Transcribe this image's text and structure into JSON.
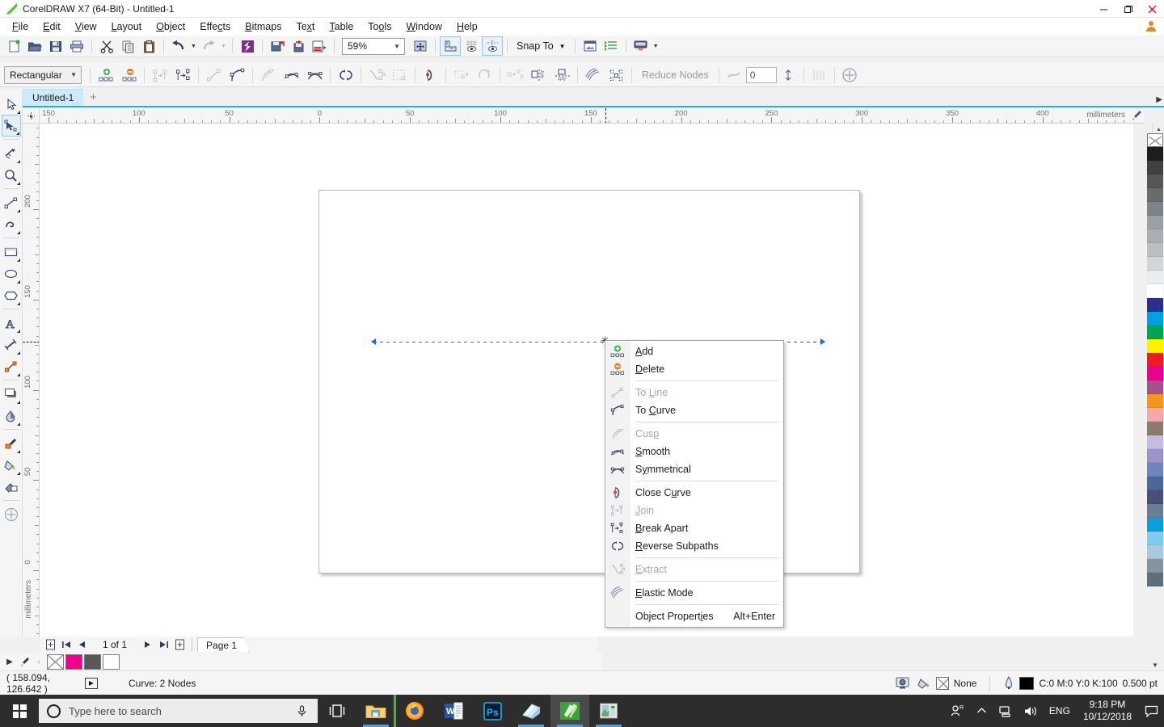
{
  "window": {
    "title": "CorelDRAW X7 (64-Bit) - Untitled-1",
    "app_icon": "coreldraw-icon",
    "minimize_label": "—",
    "maximize_label": "❐",
    "close_label": "✕"
  },
  "menubar": {
    "items": [
      {
        "label": "File",
        "accel": "F"
      },
      {
        "label": "Edit",
        "accel": "E"
      },
      {
        "label": "View",
        "accel": "V"
      },
      {
        "label": "Layout",
        "accel": "L"
      },
      {
        "label": "Object",
        "accel": "O"
      },
      {
        "label": "Effects",
        "accel": "c"
      },
      {
        "label": "Bitmaps",
        "accel": "B"
      },
      {
        "label": "Text",
        "accel": "x"
      },
      {
        "label": "Table",
        "accel": "T"
      },
      {
        "label": "Tools",
        "accel": "o"
      },
      {
        "label": "Window",
        "accel": "W"
      },
      {
        "label": "Help",
        "accel": "H"
      }
    ]
  },
  "standard_toolbar": {
    "buttons": [
      {
        "name": "new-document-icon",
        "title": "New"
      },
      {
        "name": "open-document-icon",
        "title": "Open"
      },
      {
        "name": "save-icon",
        "title": "Save"
      },
      {
        "name": "print-icon",
        "title": "Print"
      },
      {
        "name": "cut-icon",
        "title": "Cut"
      },
      {
        "name": "copy-icon",
        "title": "Copy"
      },
      {
        "name": "paste-icon",
        "title": "Paste"
      },
      {
        "name": "undo-icon",
        "title": "Undo"
      },
      {
        "name": "redo-icon",
        "title": "Redo"
      },
      {
        "name": "corel-connect-icon",
        "title": "Corel CONNECT"
      },
      {
        "name": "import-icon",
        "title": "Import"
      },
      {
        "name": "export-icon",
        "title": "Export"
      },
      {
        "name": "publish-pdf-icon",
        "title": "Publish to PDF"
      }
    ],
    "zoom_level": "59%",
    "zoom_dropdown_arrow": "⌄",
    "fullscreen_icon": "zoom-fit-icon",
    "rulers_icon": "show-rulers-icon",
    "grid_icon": "show-grid-icon",
    "guides_icon": "show-guides-icon",
    "snap_to_label": "Snap To",
    "snap_to_arrow": "▾",
    "options_icon": "options-icon",
    "object_manager_icon": "object-manager-icon",
    "application_launcher_icon": "application-launcher-icon",
    "launcher_arrow": "▾"
  },
  "property_bar": {
    "selection_mode": "Rectangular",
    "selection_mode_arrow": "⌄",
    "buttons": [
      {
        "name": "add-node-icon",
        "label": "Add Node(s)",
        "disabled": false
      },
      {
        "name": "delete-node-icon",
        "label": "Delete Node(s)",
        "disabled": false
      },
      {
        "name": "join-nodes-icon",
        "label": "Join Two Nodes",
        "disabled": true
      },
      {
        "name": "break-curve-icon",
        "label": "Break Curve",
        "disabled": false
      },
      {
        "name": "to-line-icon",
        "label": "Convert To Line",
        "disabled": true
      },
      {
        "name": "to-curve-icon",
        "label": "Convert To Curve",
        "disabled": false
      },
      {
        "name": "cusp-node-icon",
        "label": "Cusp Node",
        "disabled": true
      },
      {
        "name": "smooth-node-icon",
        "label": "Smooth Node",
        "disabled": false
      },
      {
        "name": "symmetrical-node-icon",
        "label": "Symmetrical Node",
        "disabled": false
      },
      {
        "name": "reverse-direction-icon",
        "label": "Reverse Direction",
        "disabled": false
      },
      {
        "name": "extend-curve-icon",
        "label": "Extend Curve To Close",
        "disabled": true
      },
      {
        "name": "extract-subpath-icon",
        "label": "Extract Subpath",
        "disabled": true
      },
      {
        "name": "close-curve-icon",
        "label": "Close Curve",
        "disabled": false
      },
      {
        "name": "stretch-nodes-icon",
        "label": "Stretch and Scale Nodes",
        "disabled": true
      },
      {
        "name": "rotate-nodes-icon",
        "label": "Rotate and Skew Nodes",
        "disabled": true
      },
      {
        "name": "align-nodes-icon",
        "label": "Align Nodes",
        "disabled": true
      },
      {
        "name": "reflect-horizontal-icon",
        "label": "Reflect Nodes Horizontally",
        "disabled": false
      },
      {
        "name": "reflect-vertical-icon",
        "label": "Reflect Nodes Vertically",
        "disabled": false
      },
      {
        "name": "elastic-mode-icon",
        "label": "Elastic Mode",
        "disabled": false
      },
      {
        "name": "select-all-nodes-icon",
        "label": "Select All Nodes",
        "disabled": false
      }
    ],
    "reduce_nodes_label": "Reduce Nodes",
    "curve_smoothness_value": "0",
    "curve_smoothness_icon": "curve-smoothness-icon",
    "spinner_icon": "spinner-icon",
    "zoom_nodes_icon": "zoom-nodes-icon",
    "add_node_plus_icon": "add-circle-icon"
  },
  "document_tabs": {
    "tabs": [
      {
        "label": "Untitled-1",
        "active": true
      }
    ],
    "new_tab_label": "+"
  },
  "toolbox": {
    "tools": [
      {
        "name": "pick-tool",
        "label": "Pick Tool",
        "selected": false,
        "flyout": true
      },
      {
        "name": "shape-tool",
        "label": "Shape Tool",
        "selected": true,
        "flyout": true
      },
      {
        "name": "crop-tool",
        "label": "Crop Tool",
        "selected": false,
        "flyout": true
      },
      {
        "name": "zoom-tool",
        "label": "Zoom Tool",
        "selected": false,
        "flyout": true
      },
      {
        "name": "freehand-tool",
        "label": "Freehand Tool",
        "selected": false,
        "flyout": true
      },
      {
        "name": "smart-fill-tool",
        "label": "Smart Fill Tool",
        "selected": false,
        "flyout": true
      },
      {
        "name": "rectangle-tool",
        "label": "Rectangle Tool",
        "selected": false,
        "flyout": true
      },
      {
        "name": "ellipse-tool",
        "label": "Ellipse Tool",
        "selected": false,
        "flyout": true
      },
      {
        "name": "polygon-tool",
        "label": "Polygon Tool",
        "selected": false,
        "flyout": true
      },
      {
        "name": "text-tool",
        "label": "Text Tool",
        "selected": false,
        "flyout": true
      },
      {
        "name": "parallel-dimension-tool",
        "label": "Parallel Dimension Tool",
        "selected": false,
        "flyout": true
      },
      {
        "name": "straight-line-connector-tool",
        "label": "Straight-Line Connector",
        "selected": false,
        "flyout": true
      },
      {
        "name": "drop-shadow-tool",
        "label": "Drop Shadow Tool",
        "selected": false,
        "flyout": true
      },
      {
        "name": "transparency-tool",
        "label": "Transparency Tool",
        "selected": false,
        "flyout": true
      },
      {
        "name": "color-eyedropper-tool",
        "label": "Color Eyedropper Tool",
        "selected": false,
        "flyout": true
      },
      {
        "name": "fill-tool",
        "label": "Fill Tool",
        "selected": false,
        "flyout": true
      },
      {
        "name": "interactive-fill-tool",
        "label": "Interactive Fill Tool",
        "selected": false,
        "flyout": false
      },
      {
        "name": "add-tool-button",
        "label": "Add Tool",
        "selected": false,
        "flyout": false
      }
    ]
  },
  "rulers": {
    "unit": "millimeters",
    "horizontal_labels": [
      "150",
      "100",
      "50",
      "0",
      "50",
      "100",
      "150",
      "200",
      "250",
      "300",
      "350",
      "400"
    ],
    "vertical_labels": [
      "200",
      "150",
      "100",
      "50",
      "0"
    ],
    "corner_icon": "ruler-origin-icon",
    "eyedropper_icon": "ruler-eyedropper-icon"
  },
  "canvas": {
    "object_description": "Curve with 2 nodes selected",
    "node_marker": "✦"
  },
  "context_menu": {
    "items": [
      {
        "label": "Add",
        "accel_char": "A",
        "icon": "add-node-icon",
        "disabled": false,
        "shortcut": ""
      },
      {
        "label": "Delete",
        "accel_char": "D",
        "icon": "delete-node-icon",
        "disabled": false,
        "shortcut": ""
      },
      {
        "separator": true
      },
      {
        "label": "To Line",
        "accel_char": "L",
        "icon": "to-line-icon",
        "disabled": true,
        "shortcut": ""
      },
      {
        "label": "To Curve",
        "accel_char": "C",
        "icon": "to-curve-icon",
        "disabled": false,
        "shortcut": ""
      },
      {
        "separator": true
      },
      {
        "label": "Cusp",
        "accel_char": "p",
        "icon": "cusp-node-icon",
        "disabled": true,
        "shortcut": ""
      },
      {
        "label": "Smooth",
        "accel_char": "S",
        "icon": "smooth-node-icon",
        "disabled": false,
        "shortcut": ""
      },
      {
        "label": "Symmetrical",
        "accel_char": "y",
        "icon": "symmetrical-node-icon",
        "disabled": false,
        "shortcut": ""
      },
      {
        "separator": true
      },
      {
        "label": "Close Curve",
        "accel_char": "u",
        "icon": "close-curve-icon",
        "disabled": false,
        "shortcut": ""
      },
      {
        "label": "Join",
        "accel_char": "J",
        "icon": "join-nodes-icon",
        "disabled": true,
        "shortcut": ""
      },
      {
        "label": "Break Apart",
        "accel_char": "B",
        "icon": "break-apart-icon",
        "disabled": false,
        "shortcut": ""
      },
      {
        "label": "Reverse Subpaths",
        "accel_char": "R",
        "icon": "reverse-subpaths-icon",
        "disabled": false,
        "shortcut": ""
      },
      {
        "separator": true
      },
      {
        "label": "Extract",
        "accel_char": "E",
        "icon": "extract-subpath-icon",
        "disabled": true,
        "shortcut": ""
      },
      {
        "separator": true
      },
      {
        "label": "Elastic Mode",
        "accel_char": "E",
        "icon": "elastic-mode-icon",
        "disabled": false,
        "shortcut": ""
      },
      {
        "separator": true
      },
      {
        "label": "Object Properties",
        "accel_char": "i",
        "icon": "",
        "disabled": false,
        "shortcut": "Alt+Enter"
      }
    ]
  },
  "page_navigator": {
    "add_page_start_icon": "add-page-icon",
    "first_page_icon": "⏮",
    "prev_page_icon": "◀",
    "page_count_label": "1 of 1",
    "next_page_icon": "▶",
    "last_page_icon": "⏭",
    "add_page_end_icon": "add-page-icon",
    "page_tab_label": "Page 1"
  },
  "quick_palette": {
    "expand_icon": "▶",
    "eyedropper_icon": "eyedropper-icon",
    "back_icon": "‹",
    "swatches": [
      "none",
      "#ec008c",
      "#58585a",
      "#ffffff"
    ]
  },
  "status_bar": {
    "coordinates": "( 158.094, 126.642 )",
    "play_icon": "▶",
    "object_info": "Curve: 2 Nodes",
    "snapshot_icon": "snapshot-icon",
    "fill_icon": "fill-bucket-icon",
    "fill_value": "None",
    "outline_icon": "outline-pen-icon",
    "outline_color_swatch": "#000000",
    "outline_value": "C:0 M:0 Y:0 K:100",
    "outline_width": "0.500 pt"
  },
  "color_palette": {
    "colors": [
      "none",
      "#1e1e1e",
      "#404040",
      "#565656",
      "#6b6b6b",
      "#7d8489",
      "#9aa0a6",
      "#a8aeb3",
      "#b9bfc3",
      "#d1d6d9",
      "#e9edef",
      "#ffffff",
      "#2b3090",
      "#00a0e3",
      "#00a651",
      "#fff200",
      "#ed1c24",
      "#ec008c",
      "#a5518c",
      "#f7941d",
      "#f4a9a8",
      "#8c7b6e",
      "#c5bddf",
      "#9a94c8",
      "#6f83bd",
      "#4a6797",
      "#4b4f77",
      "#697e92",
      "#0d9ddb",
      "#7fcbf0",
      "#a9c9de",
      "#84959f",
      "#5f6f78"
    ],
    "scroll_down_icon": "⌄"
  },
  "taskbar": {
    "start_label": "Start",
    "search_placeholder": "Type here to search",
    "search_circle_icon": "cortana-icon",
    "mic_icon": "🎙",
    "apps": [
      {
        "name": "task-view-icon",
        "label": "Task View",
        "running": false,
        "active": false
      },
      {
        "name": "file-explorer-icon",
        "label": "File Explorer",
        "running": true,
        "active": false
      },
      {
        "name": "firefox-icon",
        "label": "Mozilla Firefox",
        "running": true,
        "active": false
      },
      {
        "name": "word-icon",
        "label": "Microsoft Word",
        "running": false,
        "active": false
      },
      {
        "name": "photoshop-icon",
        "label": "Adobe Photoshop",
        "running": false,
        "active": false
      },
      {
        "name": "notes-icon",
        "label": "Sticky Notes",
        "running": true,
        "active": false
      },
      {
        "name": "coreldraw-icon",
        "label": "CorelDRAW X7",
        "running": true,
        "active": true
      },
      {
        "name": "corel-photo-paint-icon",
        "label": "Corel PHOTO-PAINT",
        "running": true,
        "active": false
      }
    ],
    "tray": {
      "people_icon": "people-icon",
      "chevron_up_icon": "∧",
      "network_icon": "network-icon",
      "volume_icon": "volume-icon",
      "language": "ENG",
      "time": "9:18 PM",
      "date": "10/12/2018",
      "action_center_icon": "action-center-icon"
    }
  }
}
